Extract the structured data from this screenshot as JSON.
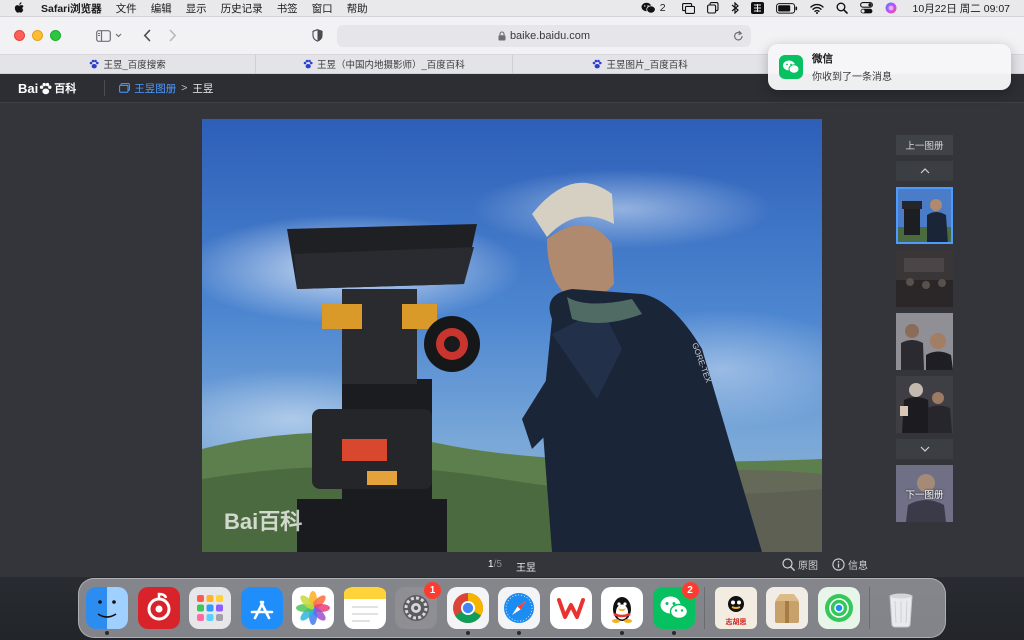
{
  "menubar": {
    "app_name": "Safari浏览器",
    "menus": [
      "文件",
      "编辑",
      "显示",
      "历史记录",
      "书签",
      "窗口",
      "帮助"
    ],
    "wechat_count": "2",
    "datetime": "10月22日 周二  09:07"
  },
  "toolbar": {
    "url": "baike.baidu.com"
  },
  "tabs": [
    {
      "title": "王昱_百度搜索"
    },
    {
      "title": "王昱（中国内地摄影师）_百度百科"
    },
    {
      "title": "王昱图片_百度百科"
    }
  ],
  "notification": {
    "app": "微信",
    "message": "你收到了一条消息"
  },
  "gallery": {
    "logo_text": "Bai",
    "logo_cn": "百科",
    "breadcrumb_album": "王昱图册",
    "breadcrumb_sep": ">",
    "breadcrumb_current": "王昱",
    "counter_current": "1",
    "counter_total": "/5",
    "caption": "王昱",
    "original_label": "原图",
    "info_label": "信息",
    "prev_album": "上一图册",
    "next_album": "下一图册",
    "watermark": "Bai百科"
  },
  "dock": {
    "settings_badge": "1",
    "wechat_badge": "2",
    "book_label": "志胡思"
  },
  "colors": {
    "accent_link": "#4e9bff",
    "badge_red": "#ff3b30",
    "wechat_green": "#07c160"
  }
}
